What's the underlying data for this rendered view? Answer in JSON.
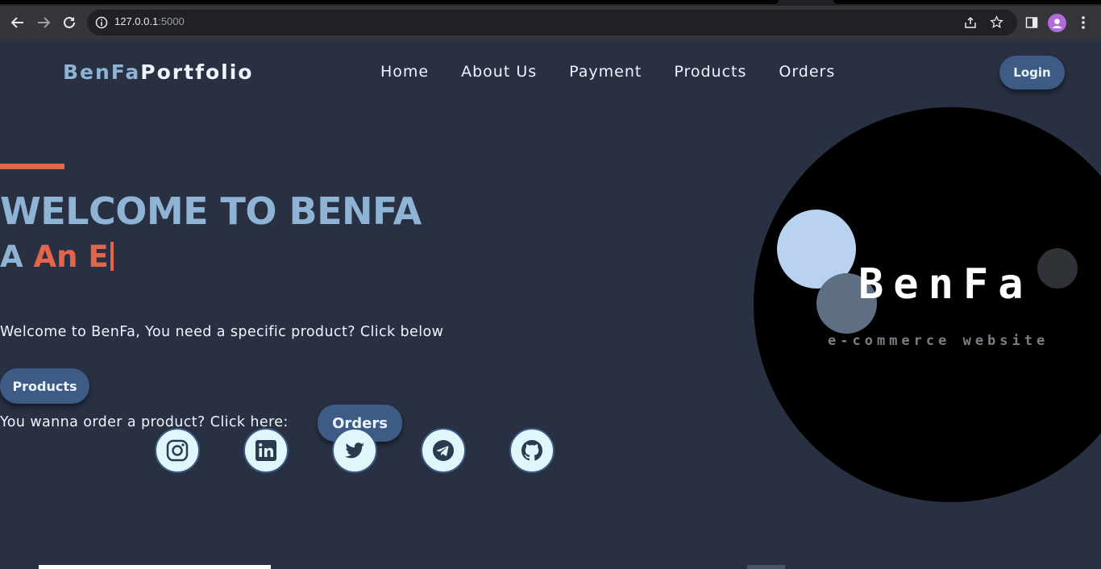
{
  "browser": {
    "url_host": "127.0.0.1",
    "url_port": ":5000"
  },
  "brand": {
    "part1": "BenFa",
    "part2": "Portfolio"
  },
  "nav": [
    "Home",
    "About Us",
    "Payment",
    "Products",
    "Orders"
  ],
  "login_label": "Login",
  "hero": {
    "headline": "WELCOME TO BENFA",
    "typed_prefix": "A ",
    "typed_text": "An E",
    "intro": "Welcome to BenFa, You need a specific product? Click below",
    "products_label": "Products",
    "order_text": "You wanna order a product? Click here:",
    "orders_label": "Orders"
  },
  "social": [
    "instagram-icon",
    "linkedin-icon",
    "twitter-icon",
    "telegram-icon",
    "github-icon"
  ],
  "hero_graphic": {
    "word": "BenFa",
    "subtitle": "e-commerce website"
  },
  "colors": {
    "background": "#283041",
    "accent": "#e5654a",
    "primary_light": "#8fb3d4",
    "button": "#3d5b85"
  }
}
